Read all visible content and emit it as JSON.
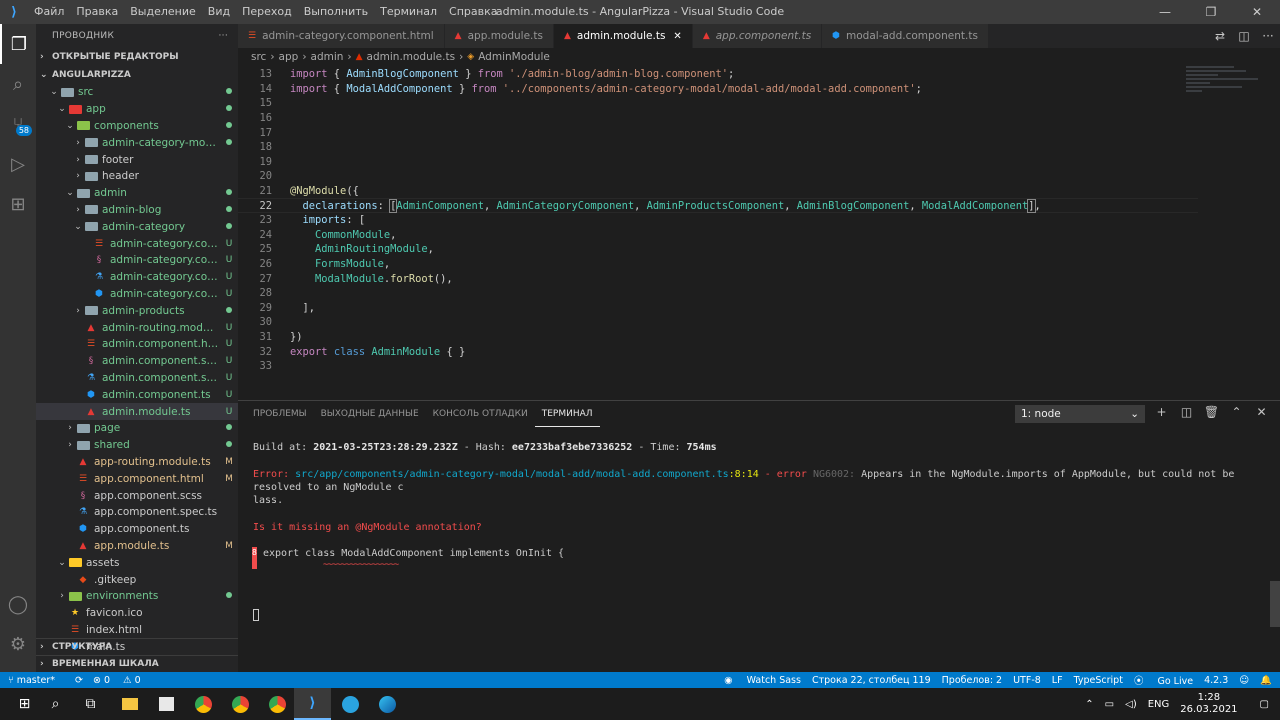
{
  "window": {
    "title": "admin.module.ts - AngularPizza - Visual Studio Code",
    "menu": [
      "Файл",
      "Правка",
      "Выделение",
      "Вид",
      "Переход",
      "Выполнить",
      "Терминал",
      "Справка"
    ]
  },
  "activity": {
    "scm_badge": "58"
  },
  "sidebar": {
    "header": "ПРОВОДНИК",
    "open_editors": "ОТКРЫТЫЕ РЕДАКТОРЫ",
    "project": "ANGULARPIZZA",
    "tree": [
      {
        "label": "src",
        "depth": 1,
        "type": "folder-open",
        "status": "dot"
      },
      {
        "label": "app",
        "depth": 2,
        "type": "folder-app",
        "status": "dot"
      },
      {
        "label": "components",
        "depth": 3,
        "type": "folder-comp",
        "status": "dot"
      },
      {
        "label": "admin-category-modal",
        "depth": 4,
        "type": "folder",
        "status": "dot"
      },
      {
        "label": "footer",
        "depth": 4,
        "type": "folder",
        "status": ""
      },
      {
        "label": "header",
        "depth": 4,
        "type": "folder",
        "status": ""
      },
      {
        "label": "admin",
        "depth": 3,
        "type": "folder-open",
        "status": "dot"
      },
      {
        "label": "admin-blog",
        "depth": 4,
        "type": "folder",
        "status": "dot"
      },
      {
        "label": "admin-category",
        "depth": 4,
        "type": "folder-open",
        "status": "dot"
      },
      {
        "label": "admin-category.compo...",
        "depth": 5,
        "type": "html",
        "status": "U"
      },
      {
        "label": "admin-category.compo...",
        "depth": 5,
        "type": "scss",
        "status": "U"
      },
      {
        "label": "admin-category.compo...",
        "depth": 5,
        "type": "spec",
        "status": "U"
      },
      {
        "label": "admin-category.compo...",
        "depth": 5,
        "type": "ts",
        "status": "U"
      },
      {
        "label": "admin-products",
        "depth": 4,
        "type": "folder",
        "status": "dot"
      },
      {
        "label": "admin-routing.module.ts",
        "depth": 4,
        "type": "ng",
        "status": "U"
      },
      {
        "label": "admin.component.html",
        "depth": 4,
        "type": "html",
        "status": "U"
      },
      {
        "label": "admin.component.scss",
        "depth": 4,
        "type": "scss",
        "status": "U"
      },
      {
        "label": "admin.component.spec.ts",
        "depth": 4,
        "type": "spec",
        "status": "U"
      },
      {
        "label": "admin.component.ts",
        "depth": 4,
        "type": "ts",
        "status": "U"
      },
      {
        "label": "admin.module.ts",
        "depth": 4,
        "type": "ng",
        "status": "U",
        "selected": true
      },
      {
        "label": "page",
        "depth": 3,
        "type": "folder",
        "status": "dot"
      },
      {
        "label": "shared",
        "depth": 3,
        "type": "folder",
        "status": "dot"
      },
      {
        "label": "app-routing.module.ts",
        "depth": 3,
        "type": "ng",
        "status": "M"
      },
      {
        "label": "app.component.html",
        "depth": 3,
        "type": "html",
        "status": "M"
      },
      {
        "label": "app.component.scss",
        "depth": 3,
        "type": "scss",
        "status": ""
      },
      {
        "label": "app.component.spec.ts",
        "depth": 3,
        "type": "spec",
        "status": ""
      },
      {
        "label": "app.component.ts",
        "depth": 3,
        "type": "ts",
        "status": ""
      },
      {
        "label": "app.module.ts",
        "depth": 3,
        "type": "ng",
        "status": "M"
      },
      {
        "label": "assets",
        "depth": 2,
        "type": "folder-assets",
        "status": ""
      },
      {
        "label": ".gitkeep",
        "depth": 3,
        "type": "git",
        "status": ""
      },
      {
        "label": "environments",
        "depth": 2,
        "type": "folder-comp",
        "status": "dot"
      },
      {
        "label": "favicon.ico",
        "depth": 2,
        "type": "star",
        "status": ""
      },
      {
        "label": "index.html",
        "depth": 2,
        "type": "html",
        "status": ""
      },
      {
        "label": "main.ts",
        "depth": 2,
        "type": "ts",
        "status": ""
      }
    ],
    "outline": "СТРУКТУРА",
    "timeline": "ВРЕМЕННАЯ ШКАЛА"
  },
  "tabs": [
    {
      "label": "admin-category.component.html",
      "icon": "html",
      "active": false,
      "italic": false
    },
    {
      "label": "app.module.ts",
      "icon": "ng",
      "active": false,
      "italic": false
    },
    {
      "label": "admin.module.ts",
      "icon": "ng",
      "active": true,
      "italic": false
    },
    {
      "label": "app.component.ts",
      "icon": "ng",
      "active": false,
      "italic": true
    },
    {
      "label": "modal-add.component.ts",
      "icon": "ts",
      "active": false,
      "italic": false
    }
  ],
  "breadcrumb": [
    "src",
    "app",
    "admin",
    "admin.module.ts",
    "AdminModule"
  ],
  "code": {
    "current_line": 22,
    "lines": [
      {
        "n": 13,
        "html": "<span class=\"kc\">import</span> { <span class=\"p\">AdminBlogComponent</span> } <span class=\"kc\">from</span> <span class=\"s\">'./admin-blog/admin-blog.component'</span>;"
      },
      {
        "n": 14,
        "html": "<span class=\"kc\">import</span> { <span class=\"p\">ModalAddComponent</span> } <span class=\"kc\">from</span> <span class=\"s\">'../components/admin-category-modal/modal-add/modal-add.component'</span>;"
      },
      {
        "n": 15,
        "html": ""
      },
      {
        "n": 16,
        "html": ""
      },
      {
        "n": 17,
        "html": ""
      },
      {
        "n": 18,
        "html": ""
      },
      {
        "n": 19,
        "html": ""
      },
      {
        "n": 20,
        "html": ""
      },
      {
        "n": 21,
        "html": "<span class=\"d\">@</span><span class=\"f\">NgModule</span>({"
      },
      {
        "n": 22,
        "html": "  <span class=\"p\">declarations</span>: <span style=\"outline:1px solid #888\">[</span><span class=\"cl\">AdminComponent</span>, <span class=\"cl\">AdminCategoryComponent</span>, <span class=\"cl\">AdminProductsComponent</span>, <span class=\"cl\">AdminBlogComponent</span>, <span class=\"cl\">ModalAddComponent</span><span style=\"outline:1px solid #888\">]</span>,"
      },
      {
        "n": 23,
        "html": "  <span class=\"p\">imports</span>: ["
      },
      {
        "n": 24,
        "html": "    <span class=\"cl\">CommonModule</span>,"
      },
      {
        "n": 25,
        "html": "    <span class=\"cl\">AdminRoutingModule</span>,"
      },
      {
        "n": 26,
        "html": "    <span class=\"cl\">FormsModule</span>,"
      },
      {
        "n": 27,
        "html": "    <span class=\"cl\">ModalModule</span>.<span class=\"f\">forRoot</span>(),"
      },
      {
        "n": 28,
        "html": ""
      },
      {
        "n": 29,
        "html": "  ],"
      },
      {
        "n": 30,
        "html": ""
      },
      {
        "n": 31,
        "html": "})"
      },
      {
        "n": 32,
        "html": "<span class=\"kc\">export</span> <span class=\"k\">class</span> <span class=\"cl\">AdminModule</span> { }"
      },
      {
        "n": 33,
        "html": ""
      }
    ]
  },
  "panel": {
    "tabs": [
      {
        "label": "ПРОБЛЕМЫ",
        "active": false
      },
      {
        "label": "ВЫХОДНЫЕ ДАННЫЕ",
        "active": false
      },
      {
        "label": "КОНСОЛЬ ОТЛАДКИ",
        "active": false
      },
      {
        "label": "ТЕРМИНАЛ",
        "active": true
      }
    ],
    "terminal_select": "1: node"
  },
  "terminal": {
    "build_label": "Build at: ",
    "build_time": "2021-03-25T23:28:29.232Z",
    "hash_label": " - Hash: ",
    "hash": "ee7233baf3ebe7336252",
    "time_label": " - Time: ",
    "time": "754",
    "time_unit": "ms",
    "error_label": "Error: ",
    "error_path": "src/app/components/admin-category-modal/modal-add/modal-add.component.ts",
    "error_pos": ":8:14",
    "error_word": " - error ",
    "error_code": "NG6002: ",
    "error_msg": "Appears in the NgModule.imports of AppModule, but could not be resolved to an NgModule c",
    "error_msg2": "lass.",
    "hint": "Is it missing an @NgModule annotation?",
    "snippet_num": "8",
    "snippet": "export class ModalAddComponent implements OnInit {",
    "squiggle": "~~~~~~~~~~~~~~~~~"
  },
  "status": {
    "branch": "master*",
    "sync": "",
    "errors": "0",
    "warnings": "0",
    "watch_sass": "Watch Sass",
    "position": "Строка 22, столбец 119",
    "spaces": "Пробелов: 2",
    "encoding": "UTF-8",
    "eol": "LF",
    "language": "TypeScript",
    "go_live": "Go Live",
    "version": "4.2.3"
  },
  "taskbar": {
    "lang": "ENG",
    "time": "1:28",
    "date": "26.03.2021"
  }
}
